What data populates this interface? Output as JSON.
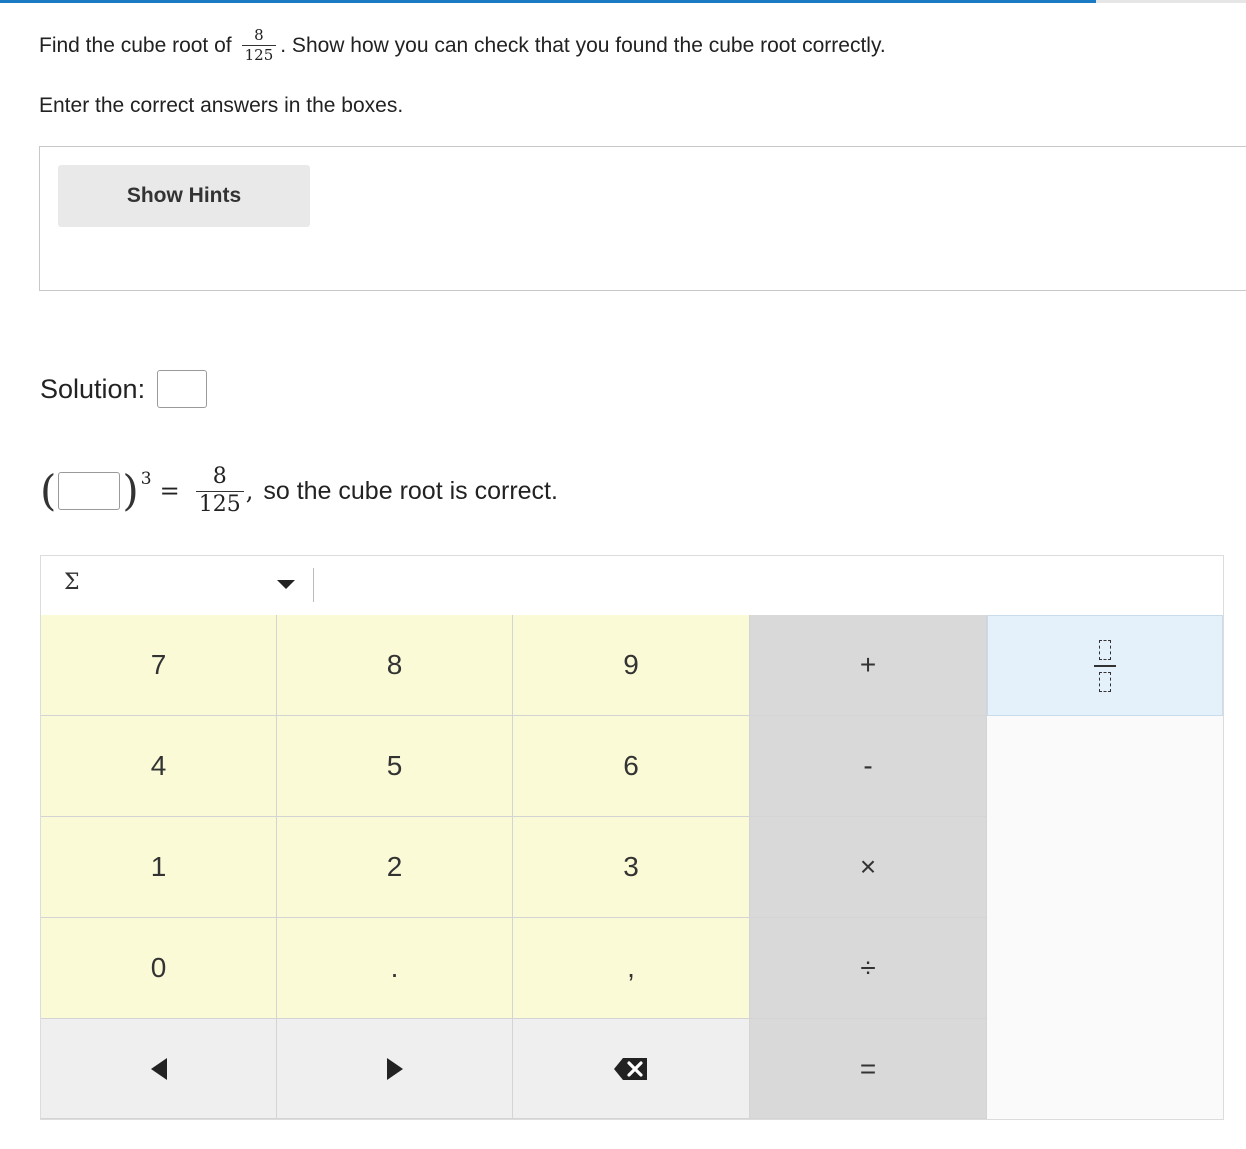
{
  "progress": {
    "fraction": 0.88,
    "color": "#1a7bc4"
  },
  "question": {
    "prefix": "Find the cube root of",
    "fraction": {
      "numerator": "8",
      "denominator": "125"
    },
    "suffix": ". Show how you can check that you found the cube root correctly."
  },
  "instructions": "Enter the correct answers in the boxes.",
  "hints": {
    "button_label": "Show Hints"
  },
  "solution": {
    "label": "Solution:",
    "answer_value": ""
  },
  "check": {
    "answer_value": "",
    "exponent": "3",
    "equals": "=",
    "fraction": {
      "numerator": "8",
      "denominator": "125"
    },
    "comma": ",",
    "tail": "so the cube root is correct."
  },
  "keypad": {
    "palette_symbol": "Σ",
    "palette_icon": "chevron-down-icon",
    "keys": {
      "k7": "7",
      "k8": "8",
      "k9": "9",
      "plus": "+",
      "k4": "4",
      "k5": "5",
      "k6": "6",
      "minus": "-",
      "k1": "1",
      "k2": "2",
      "k3": "3",
      "times": "×",
      "k0": "0",
      "dot": ".",
      "comma": ",",
      "divide": "÷",
      "equals": "="
    },
    "icons": {
      "left": "arrow-left-icon",
      "right": "arrow-right-icon",
      "backspace": "backspace-icon",
      "fraction": "fraction-template-icon"
    },
    "colors": {
      "digit": "#fafad7",
      "operator": "#d9d9d9",
      "nav": "#efefef",
      "fraction": "#e4f1fb"
    }
  }
}
